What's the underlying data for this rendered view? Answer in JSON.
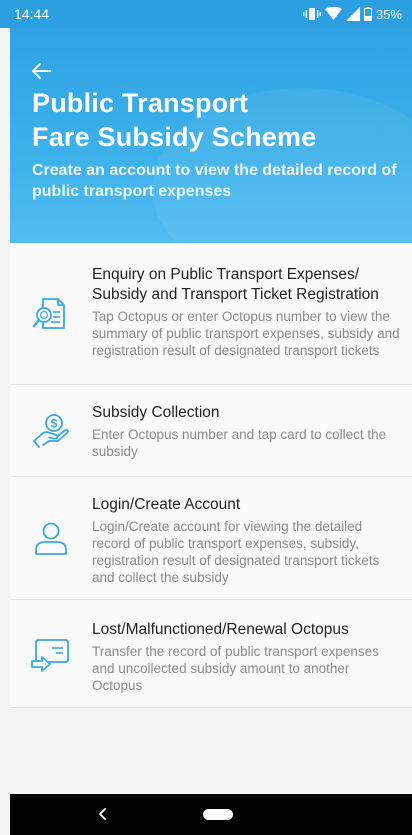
{
  "status_bar": {
    "time": "14:44",
    "battery": "35%"
  },
  "header": {
    "title_line1": "Public Transport",
    "title_line2": "Fare Subsidy Scheme",
    "subtitle": "Create an account to view the detailed record of public transport expenses"
  },
  "items": [
    {
      "title": "Enquiry on Public Transport Expenses/ Subsidy and Transport Ticket Registration",
      "desc": "Tap Octopus or enter Octopus number to view the summary of public transport expenses, subsidy and registration result of designated transport tickets",
      "icon": "document-search-icon"
    },
    {
      "title": "Subsidy Collection",
      "desc": "Enter Octopus number and tap card to collect the subsidy",
      "icon": "hand-coin-icon"
    },
    {
      "title": "Login/Create Account",
      "desc": "Login/Create account for viewing the detailed record of public transport expenses, subsidy, registration result of designated transport tickets and collect the subsidy",
      "icon": "user-icon"
    },
    {
      "title": "Lost/Malfunctioned/Renewal Octopus",
      "desc": "Transfer the record of public transport expenses and uncollected subsidy amount to another Octopus",
      "icon": "card-transfer-icon"
    }
  ],
  "colors": {
    "header_blue": "#2fa3e3",
    "icon_blue": "#3aa8e2"
  }
}
